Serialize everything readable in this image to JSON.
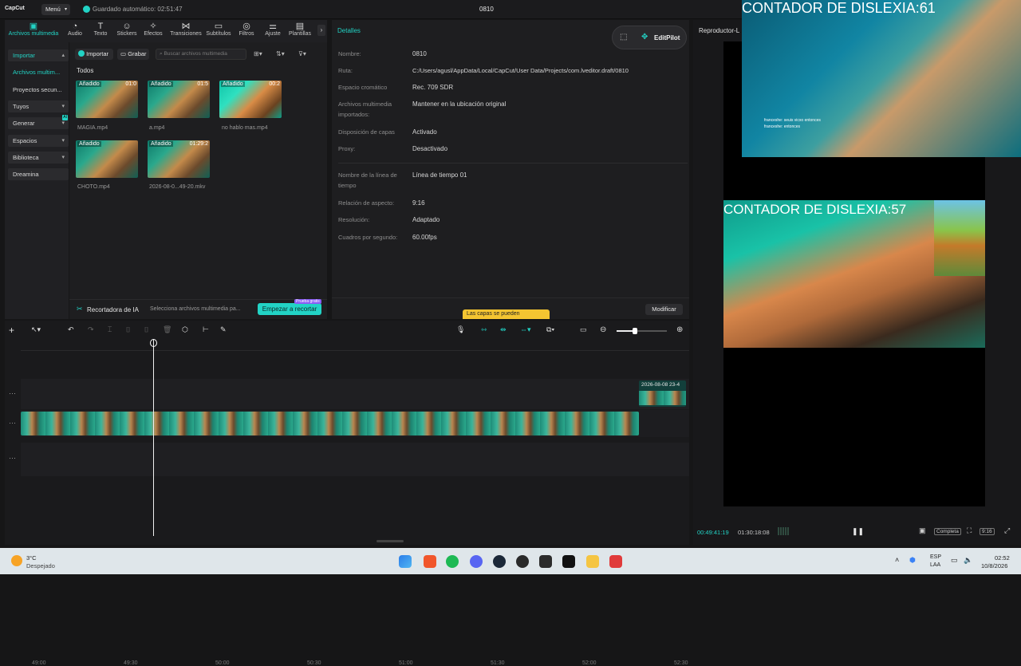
{
  "app": {
    "logo": "CapCut",
    "menu_label": "Menú",
    "autosave": "Guardado automático: 02:51:47",
    "project_title": "0810"
  },
  "toolbar": {
    "tools": [
      "Archivos multimedia",
      "Audio",
      "Texto",
      "Stickers",
      "Efectos",
      "Transiciones",
      "Subtítulos",
      "Filtros",
      "Ajuste",
      "Plantillas"
    ]
  },
  "nav": {
    "items": [
      "Importar",
      "Archivos multim...",
      "Proyectos secun...",
      "Tuyos",
      "Generar",
      "Espacios",
      "Biblioteca",
      "Dreamina"
    ],
    "generar_badge": "AI"
  },
  "media": {
    "import_button": "Importar",
    "record_button": "Grabar",
    "search_placeholder": "Buscar archivos multimedia",
    "section_title": "Todos",
    "files": [
      {
        "tag": "Añadido",
        "duration": "01:0",
        "name": "MAGIA.mp4"
      },
      {
        "tag": "Añadido",
        "duration": "01:5",
        "name": "a.mp4"
      },
      {
        "tag": "Añadido",
        "duration": "00:2",
        "name": "no hablo mas.mp4"
      },
      {
        "tag": "Añadido",
        "duration": "",
        "name": "CHOTO.mp4"
      },
      {
        "tag": "Añadido",
        "duration": "01:29:2",
        "name": "2026-08-0...49-20.mkv"
      }
    ],
    "recorder_label": "Recortadora de IA",
    "recorder_hint": "Selecciona archivos multimedia pa...",
    "start_button": "Empezar a recortar",
    "promo_badge": "Prueba gratis"
  },
  "details": {
    "tab": "Detalles",
    "editpilot": "EditPilot",
    "rows": [
      {
        "label": "Nombre:",
        "value": "0810"
      },
      {
        "label": "Ruta:",
        "value": "C:/Users/agusl/AppData/Local/CapCut/User Data/Projects/com.lveditor.draft/0810"
      },
      {
        "label": "Espacio cromático",
        "value": "Rec. 709 SDR"
      },
      {
        "label": "Archivos multimedia importados:",
        "value": "Mantener en la ubicación original"
      },
      {
        "label": "Disposición de capas",
        "value": "Activado"
      },
      {
        "label": "Proxy:",
        "value": "Desactivado"
      },
      {
        "label": "Nombre de la línea de tiempo",
        "value": "Línea de tiempo 01"
      },
      {
        "label": "Relación de aspecto:",
        "value": "9:16"
      },
      {
        "label": "Resolución:",
        "value": "Adaptado"
      },
      {
        "label": "Cuadros por segundo:",
        "value": "60.00fps"
      }
    ],
    "modify_button": "Modificar",
    "tooltip": "Las capas se pueden"
  },
  "player": {
    "title": "Reproductor-L",
    "overlay_text_1": "CONTADOR DE DISLEXIA:61",
    "overlay_text_2": "CONTADOR DE DISLEXIA:57",
    "chat_1": "franceshe: seuis vicxo entonces",
    "chat_2": "franceshe: entonces",
    "current_time": "00:49:41:19",
    "total_time": "01:30:18:08",
    "full_button": "Completa",
    "ratio_button": "9:16"
  },
  "timeline": {
    "ticks": [
      "49:00",
      "49:30",
      "50:00",
      "50:30",
      "51:00",
      "51:30",
      "52:00",
      "52:30"
    ],
    "clip_label": "2026-08-08 23-4"
  },
  "taskbar": {
    "weather_temp": "3°C",
    "weather_desc": "Despejado",
    "lang_1": "ESP",
    "lang_2": "LAA",
    "time": "02:52",
    "date": "10/8/2026"
  },
  "colors": {
    "accent": "#22d3c5",
    "panel": "#1e1e20",
    "background": "#161617"
  }
}
